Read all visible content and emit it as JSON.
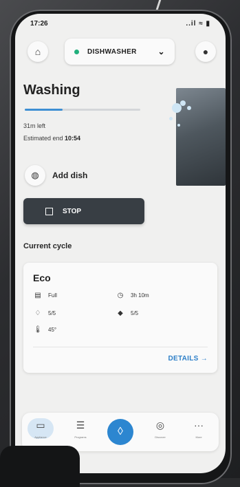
{
  "status_bar": {
    "time": "17:26",
    "icons": "..il ≈ ▮"
  },
  "header": {
    "device_label": "DISHWASHER",
    "status_color": "#22b07d"
  },
  "main": {
    "title": "Washing",
    "progress": 0.33,
    "time_left": "31m left",
    "estimated_prefix": "Estimated end ",
    "estimated_time": "10:54",
    "add_dish_label": "Add dish",
    "stop_label": "STOP"
  },
  "cycle": {
    "section_title": "Current cycle",
    "name": "Eco",
    "load": "Full",
    "duration": "3h 10m",
    "drops": "5/5",
    "tabs": "5/5",
    "temperature": "45°",
    "details_label": "DETAILS →"
  },
  "nav": {
    "items": [
      {
        "label": "Appliance"
      },
      {
        "label": "Programs"
      },
      {
        "label": "Discover"
      },
      {
        "label": "More"
      }
    ]
  },
  "colors": {
    "accent": "#2c86d0",
    "stop_bg": "#383e44",
    "progress": "#3d8fd3"
  }
}
